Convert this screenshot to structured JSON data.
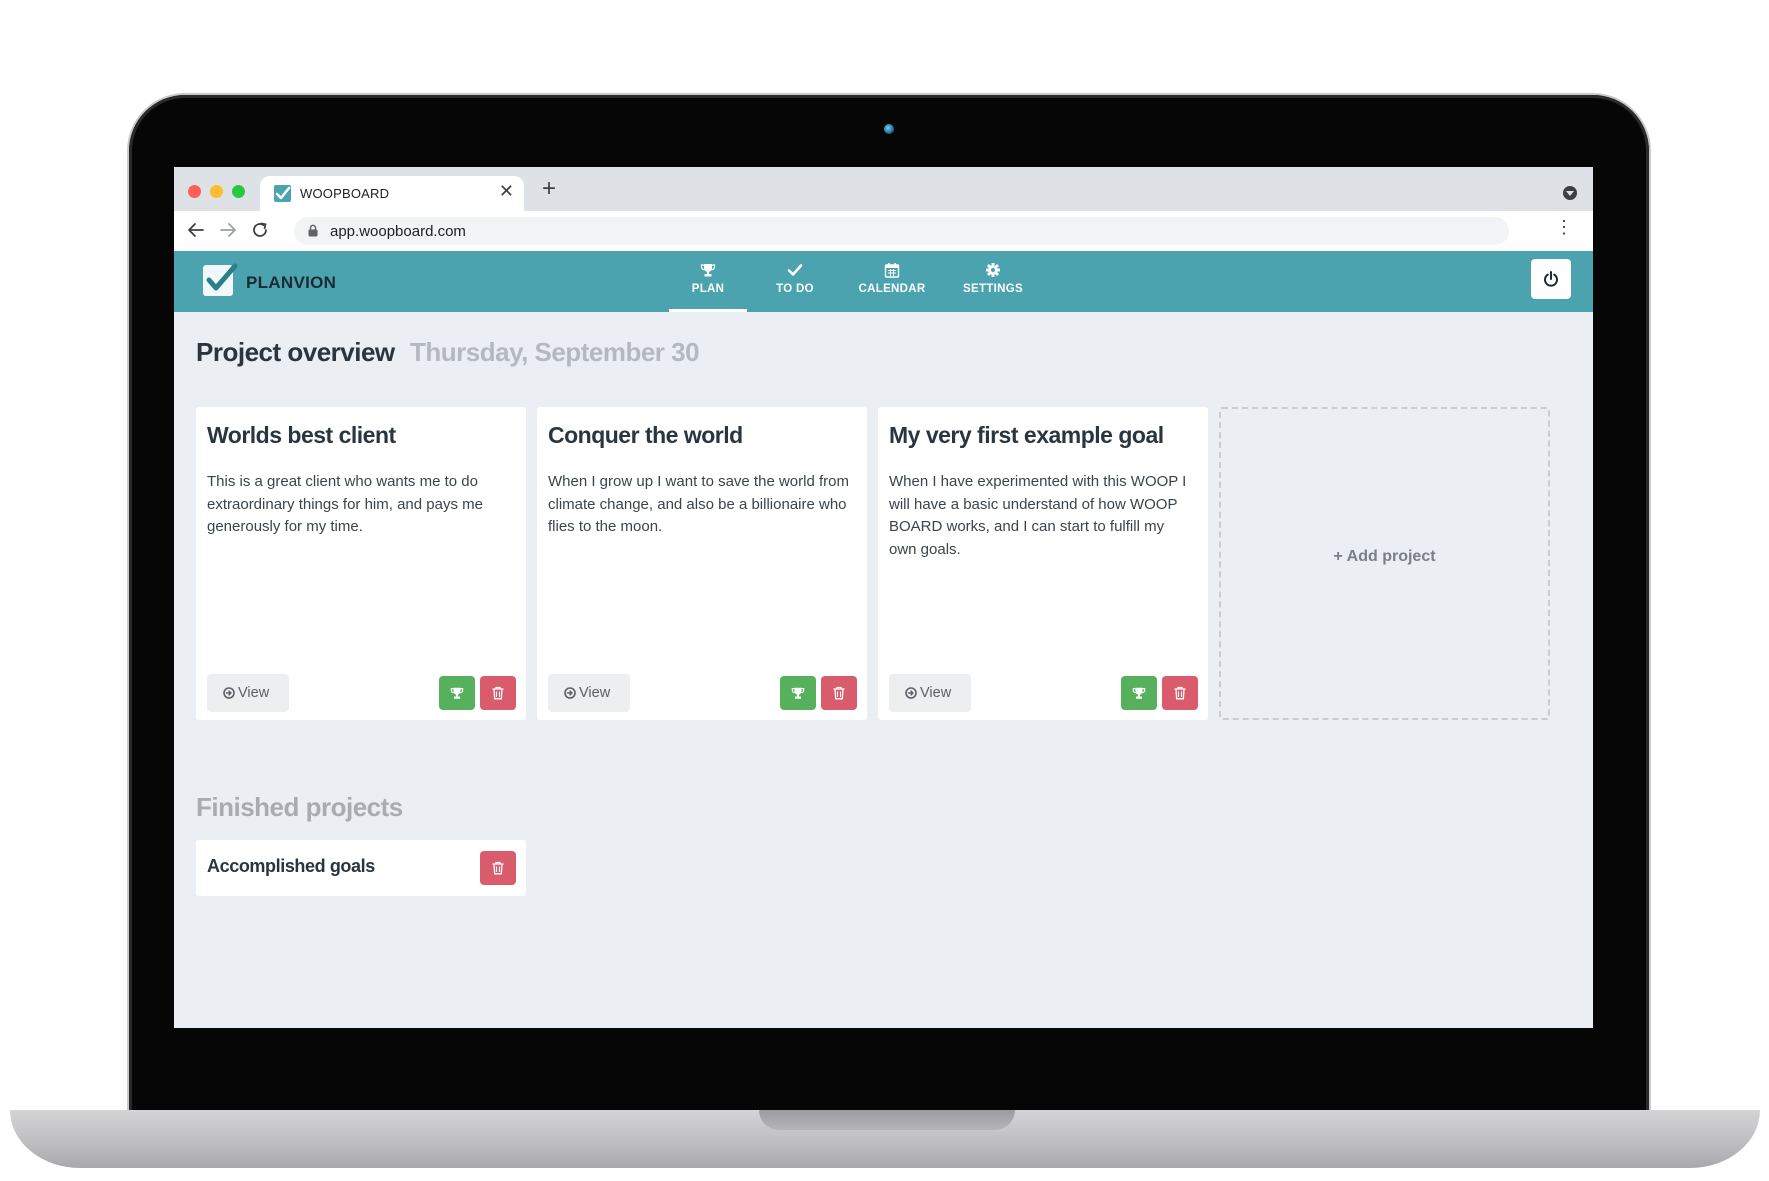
{
  "browser": {
    "tab_title": "WOOPBOARD",
    "tab_close": "✕",
    "new_tab": "+",
    "url": "app.woopboard.com",
    "icons": [
      "back-icon",
      "forward-icon",
      "reload-icon",
      "lock-icon",
      "kebab-menu-icon"
    ]
  },
  "app": {
    "brand": "PLANVION",
    "nav": [
      {
        "label": "PLAN",
        "icon": "trophy-icon",
        "active": true
      },
      {
        "label": "TO DO",
        "icon": "check-icon",
        "active": false
      },
      {
        "label": "CALENDAR",
        "icon": "calendar-icon",
        "active": false
      },
      {
        "label": "SETTINGS",
        "icon": "gear-icon",
        "active": false
      }
    ],
    "colors": {
      "header": "#4aa3ae",
      "green": "#57b05c",
      "red": "#d95c6c",
      "background": "#ebeef2"
    }
  },
  "overview": {
    "title": "Project overview",
    "date": "Thursday, September 30",
    "projects": [
      {
        "title": "Worlds best client",
        "description": "This is a great client who wants me to do extraordinary things for him, and pays me generously for my time.",
        "view_label": "View"
      },
      {
        "title": "Conquer the world",
        "description": "When I grow up I want to save the world from climate change, and also be a billionaire who flies to the moon.",
        "view_label": "View"
      },
      {
        "title": "My very first example goal",
        "description": "When I have experimented with this WOOP I will have a basic understand of how WOOP BOARD works, and I can start to fulfill my own goals.",
        "view_label": "View"
      }
    ],
    "add_label": "+ Add project"
  },
  "finished": {
    "title": "Finished projects",
    "items": [
      {
        "title": "Accomplished goals"
      }
    ]
  }
}
